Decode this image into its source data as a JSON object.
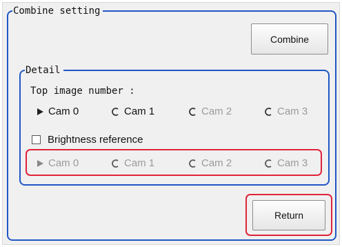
{
  "combine_group": {
    "title": "Combine setting",
    "combine_button": "Combine"
  },
  "detail_group": {
    "title": "Detail",
    "top_image_label": "Top image number :",
    "top_image_options": [
      {
        "label": "Cam 0",
        "selected": true,
        "enabled": true
      },
      {
        "label": "Cam 1",
        "selected": false,
        "enabled": true
      },
      {
        "label": "Cam 2",
        "selected": false,
        "enabled": false
      },
      {
        "label": "Cam 3",
        "selected": false,
        "enabled": true
      }
    ],
    "brightness_reference": {
      "label": "Brightness reference",
      "checked": false
    },
    "brightness_options": [
      {
        "label": "Cam 0",
        "selected": true,
        "enabled": false
      },
      {
        "label": "Cam 1",
        "selected": false,
        "enabled": false
      },
      {
        "label": "Cam 2",
        "selected": false,
        "enabled": false
      },
      {
        "label": "Cam 3",
        "selected": false,
        "enabled": false
      }
    ]
  },
  "return_button": "Return",
  "colors": {
    "group_border": "#1f56c4",
    "highlight": "#e0223a",
    "panel_bg": "#f0f0f0"
  }
}
